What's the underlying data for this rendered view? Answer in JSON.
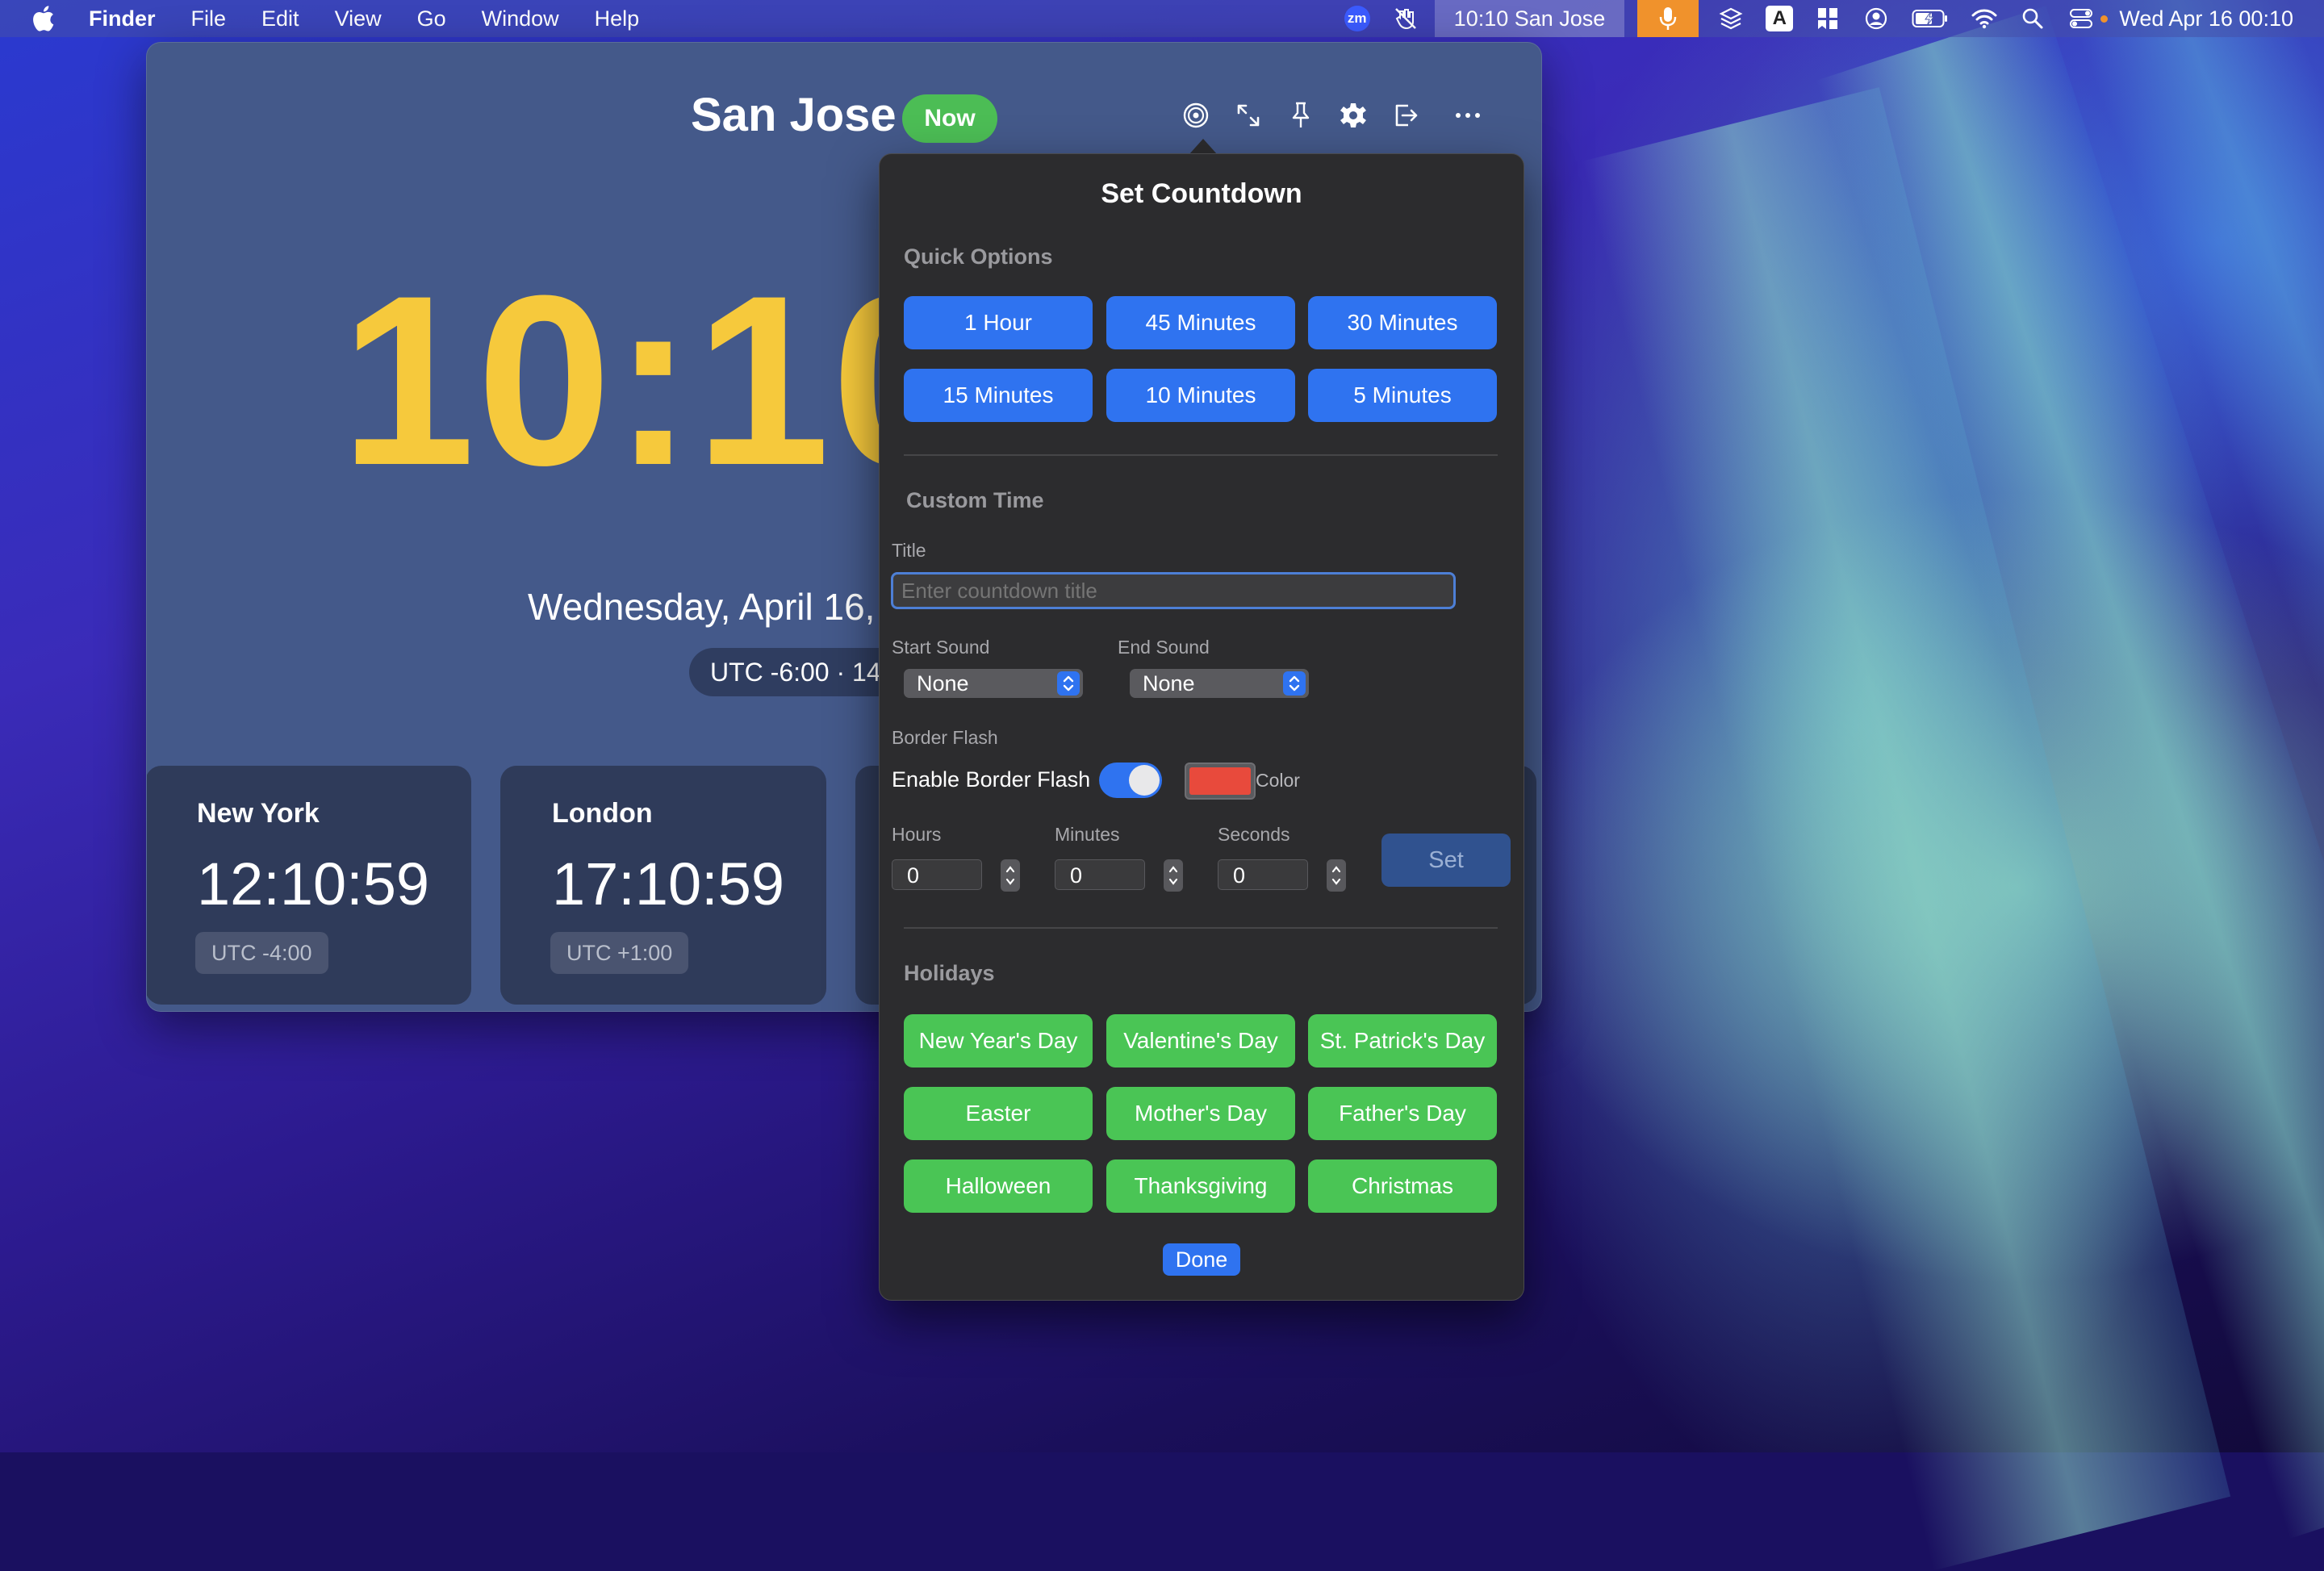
{
  "menubar": {
    "app_name": "Finder",
    "menus": [
      "File",
      "Edit",
      "View",
      "Go",
      "Window",
      "Help"
    ],
    "zoom_badge": "zm",
    "clock_widget": "10:10 San Jose",
    "input_letter": "A",
    "datetime": "Wed Apr 16  00:10"
  },
  "main_window": {
    "city": "San Jose",
    "now_badge": "Now",
    "time": "10:10",
    "date": "Wednesday, April 16,",
    "utc_info": "UTC -6:00 · 14",
    "cards": [
      {
        "city": "New York",
        "time": "12:10:59",
        "utc": "UTC -4:00"
      },
      {
        "city": "London",
        "time": "17:10:59",
        "utc": "UTC +1:00"
      }
    ]
  },
  "countdown": {
    "title": "Set Countdown",
    "quick_options_label": "Quick Options",
    "quick_options": [
      "1 Hour",
      "45 Minutes",
      "30 Minutes",
      "15 Minutes",
      "10 Minutes",
      "5 Minutes"
    ],
    "custom_time_label": "Custom Time",
    "title_label": "Title",
    "title_placeholder": "Enter countdown title",
    "start_sound_label": "Start Sound",
    "start_sound_value": "None",
    "end_sound_label": "End Sound",
    "end_sound_value": "None",
    "border_flash_label": "Border Flash",
    "enable_border_flash_label": "Enable Border Flash",
    "border_flash_enabled": true,
    "color_label": "Color",
    "flash_color": "#e84a3c",
    "hours_label": "Hours",
    "hours_value": "0",
    "minutes_label": "Minutes",
    "minutes_value": "0",
    "seconds_label": "Seconds",
    "seconds_value": "0",
    "set_label": "Set",
    "holidays_label": "Holidays",
    "holidays": [
      "New Year's Day",
      "Valentine's Day",
      "St. Patrick's Day",
      "Easter",
      "Mother's Day",
      "Father's Day",
      "Halloween",
      "Thanksgiving",
      "Christmas"
    ],
    "done_label": "Done"
  },
  "colors": {
    "accent_blue": "#2f73f0",
    "holiday_green": "#4ac555",
    "clock_yellow": "#f6c93c",
    "window_bg": "#44598a"
  }
}
